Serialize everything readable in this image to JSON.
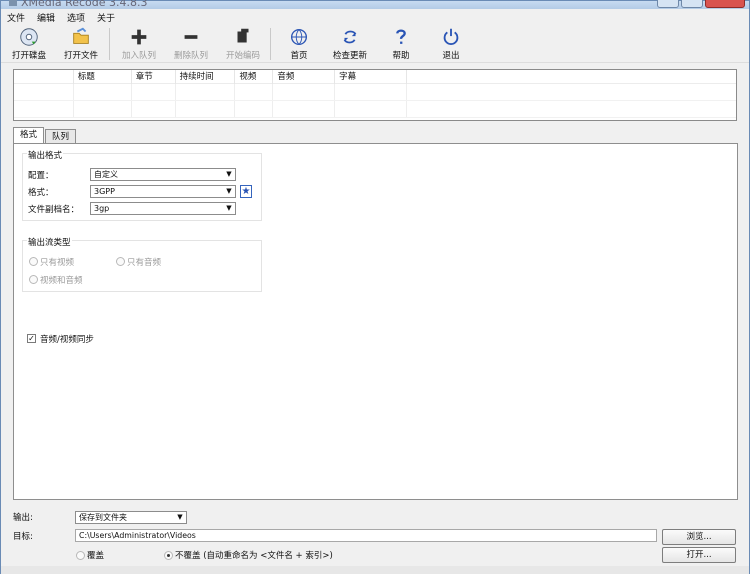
{
  "window": {
    "title": "XMedia Recode 3.4.8.3"
  },
  "menu": [
    "文件",
    "编辑",
    "选项",
    "关于"
  ],
  "toolbar": {
    "open_disc": "打开碟盘",
    "open_file": "打开文件",
    "add_queue": "加入队列",
    "remove_queue": "删除队列",
    "start_encode": "开始编码",
    "home": "首页",
    "check_update": "检查更新",
    "help": "帮助",
    "exit": "退出"
  },
  "table": {
    "columns": [
      "",
      "标题",
      "章节",
      "持续时间",
      "视频",
      "音频",
      "字幕"
    ]
  },
  "tabs": {
    "format": "格式",
    "queue": "队列"
  },
  "output_format": {
    "group_title": "输出格式",
    "profile_label": "配置：",
    "profile_value": "自定义",
    "format_label": "格式：",
    "format_value": "3GPP",
    "extension_label": "文件副档名：",
    "extension_value": "3gp"
  },
  "stream_type": {
    "group_title": "输出流类型",
    "video_only": "只有视频",
    "audio_only": "只有音频",
    "video_audio": "视频和音频"
  },
  "sync": {
    "label": "音频/视频同步",
    "checked": true
  },
  "bottom": {
    "output_label": "输出:",
    "output_value": "保存到文件夹",
    "target_label": "目标:",
    "target_path": "C:\\Users\\Administrator\\Videos",
    "browse": "浏览...",
    "overwrite": "覆盖",
    "no_overwrite": "不覆盖 (自动重命名为 <文件名 + 索引>)",
    "open": "打开..."
  },
  "icons": {
    "open_disc": "disc-icon",
    "open_file": "folder-open-icon",
    "add_queue": "plus-icon",
    "remove_queue": "minus-icon",
    "start_encode": "encode-icon",
    "home": "globe-icon",
    "check_update": "refresh-icon",
    "help": "question-icon",
    "exit": "power-icon",
    "favorite": "star-icon"
  }
}
